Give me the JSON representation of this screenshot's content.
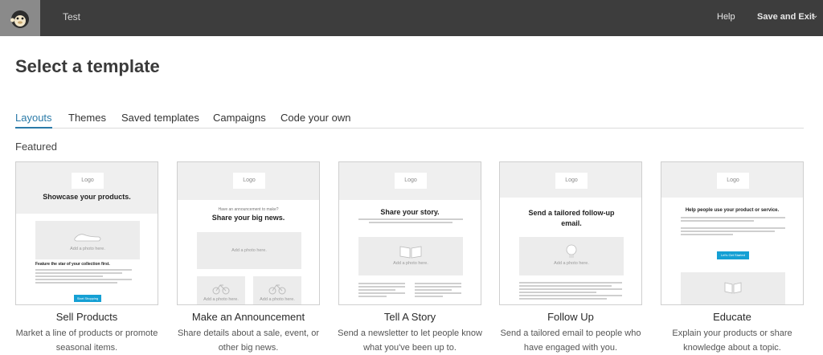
{
  "topbar": {
    "title": "Test",
    "help": "Help",
    "save_exit": "Save and Exit",
    "caret": "⌄"
  },
  "page_title": "Select a template",
  "tabs": [
    {
      "label": "Layouts",
      "active": true
    },
    {
      "label": "Themes"
    },
    {
      "label": "Saved templates"
    },
    {
      "label": "Campaigns"
    },
    {
      "label": "Code your own"
    }
  ],
  "section_label": "Featured",
  "cards": [
    {
      "title": "Sell Products",
      "description": "Market a line of products or promote seasonal items.",
      "preview": {
        "logo": "Logo",
        "headline": "Showcase your products.",
        "photo": "Add a photo here.",
        "feature": "Feature the star of your collection first.",
        "button": "Start Shopping"
      }
    },
    {
      "title": "Make an Announcement",
      "description": "Share details about a sale, event, or other big news.",
      "preview": {
        "logo": "Logo",
        "kicker": "Have an announcement to make?",
        "headline": "Share your big news.",
        "photo": "Add a photo here.",
        "photo_small": "Add a photo here."
      }
    },
    {
      "title": "Tell A Story",
      "description": "Send a newsletter to let people know what you've been up to.",
      "preview": {
        "logo": "Logo",
        "headline": "Share your story.",
        "photo": "Add a photo here."
      }
    },
    {
      "title": "Follow Up",
      "description": "Send a tailored email to people who have engaged with you.",
      "preview": {
        "logo": "Logo",
        "headline": "Send a tailored follow-up email.",
        "photo": "Add a photo here."
      }
    },
    {
      "title": "Educate",
      "description": "Explain your products or share knowledge about a topic.",
      "preview": {
        "logo": "Logo",
        "headline": "Help people use your product or service.",
        "button": "Let's Get Started"
      }
    }
  ]
}
